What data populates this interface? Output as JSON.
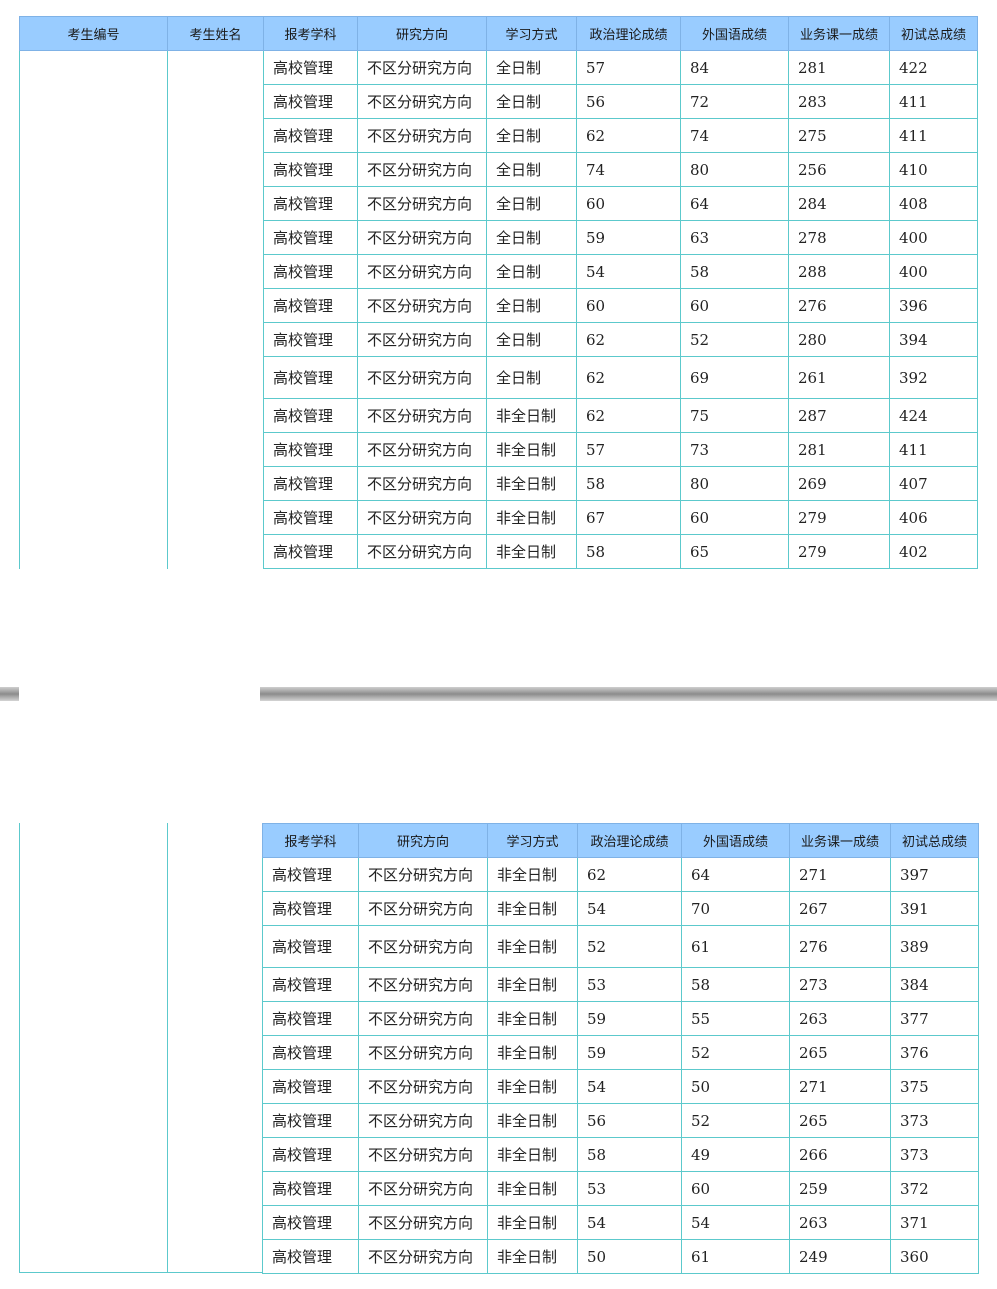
{
  "columns": [
    "考生编号",
    "考生姓名",
    "报考学科",
    "研究方向",
    "学习方式",
    "政治理论成绩",
    "外国语成绩",
    "业务课一成绩",
    "初试总成绩"
  ],
  "page1_rows": [
    [
      "高校管理",
      "不区分研究方向",
      "全日制",
      "57",
      "84",
      "281",
      "422"
    ],
    [
      "高校管理",
      "不区分研究方向",
      "全日制",
      "56",
      "72",
      "283",
      "411"
    ],
    [
      "高校管理",
      "不区分研究方向",
      "全日制",
      "62",
      "74",
      "275",
      "411"
    ],
    [
      "高校管理",
      "不区分研究方向",
      "全日制",
      "74",
      "80",
      "256",
      "410"
    ],
    [
      "高校管理",
      "不区分研究方向",
      "全日制",
      "60",
      "64",
      "284",
      "408"
    ],
    [
      "高校管理",
      "不区分研究方向",
      "全日制",
      "59",
      "63",
      "278",
      "400"
    ],
    [
      "高校管理",
      "不区分研究方向",
      "全日制",
      "54",
      "58",
      "288",
      "400"
    ],
    [
      "高校管理",
      "不区分研究方向",
      "全日制",
      "60",
      "60",
      "276",
      "396"
    ],
    [
      "高校管理",
      "不区分研究方向",
      "全日制",
      "62",
      "52",
      "280",
      "394"
    ],
    [
      "高校管理",
      "不区分研究方向",
      "全日制",
      "62",
      "69",
      "261",
      "392"
    ],
    [
      "高校管理",
      "不区分研究方向",
      "非全日制",
      "62",
      "75",
      "287",
      "424"
    ],
    [
      "高校管理",
      "不区分研究方向",
      "非全日制",
      "57",
      "73",
      "281",
      "411"
    ],
    [
      "高校管理",
      "不区分研究方向",
      "非全日制",
      "58",
      "80",
      "269",
      "407"
    ],
    [
      "高校管理",
      "不区分研究方向",
      "非全日制",
      "67",
      "60",
      "279",
      "406"
    ],
    [
      "高校管理",
      "不区分研究方向",
      "非全日制",
      "58",
      "65",
      "279",
      "402"
    ]
  ],
  "page2_rows": [
    [
      "高校管理",
      "不区分研究方向",
      "非全日制",
      "62",
      "64",
      "271",
      "397"
    ],
    [
      "高校管理",
      "不区分研究方向",
      "非全日制",
      "54",
      "70",
      "267",
      "391"
    ],
    [
      "高校管理",
      "不区分研究方向",
      "非全日制",
      "52",
      "61",
      "276",
      "389"
    ],
    [
      "高校管理",
      "不区分研究方向",
      "非全日制",
      "53",
      "58",
      "273",
      "384"
    ],
    [
      "高校管理",
      "不区分研究方向",
      "非全日制",
      "59",
      "55",
      "263",
      "377"
    ],
    [
      "高校管理",
      "不区分研究方向",
      "非全日制",
      "59",
      "52",
      "265",
      "376"
    ],
    [
      "高校管理",
      "不区分研究方向",
      "非全日制",
      "54",
      "50",
      "271",
      "375"
    ],
    [
      "高校管理",
      "不区分研究方向",
      "非全日制",
      "56",
      "52",
      "265",
      "373"
    ],
    [
      "高校管理",
      "不区分研究方向",
      "非全日制",
      "58",
      "49",
      "266",
      "373"
    ],
    [
      "高校管理",
      "不区分研究方向",
      "非全日制",
      "53",
      "60",
      "259",
      "372"
    ],
    [
      "高校管理",
      "不区分研究方向",
      "非全日制",
      "54",
      "54",
      "263",
      "371"
    ],
    [
      "高校管理",
      "不区分研究方向",
      "非全日制",
      "50",
      "61",
      "249",
      "360"
    ]
  ]
}
